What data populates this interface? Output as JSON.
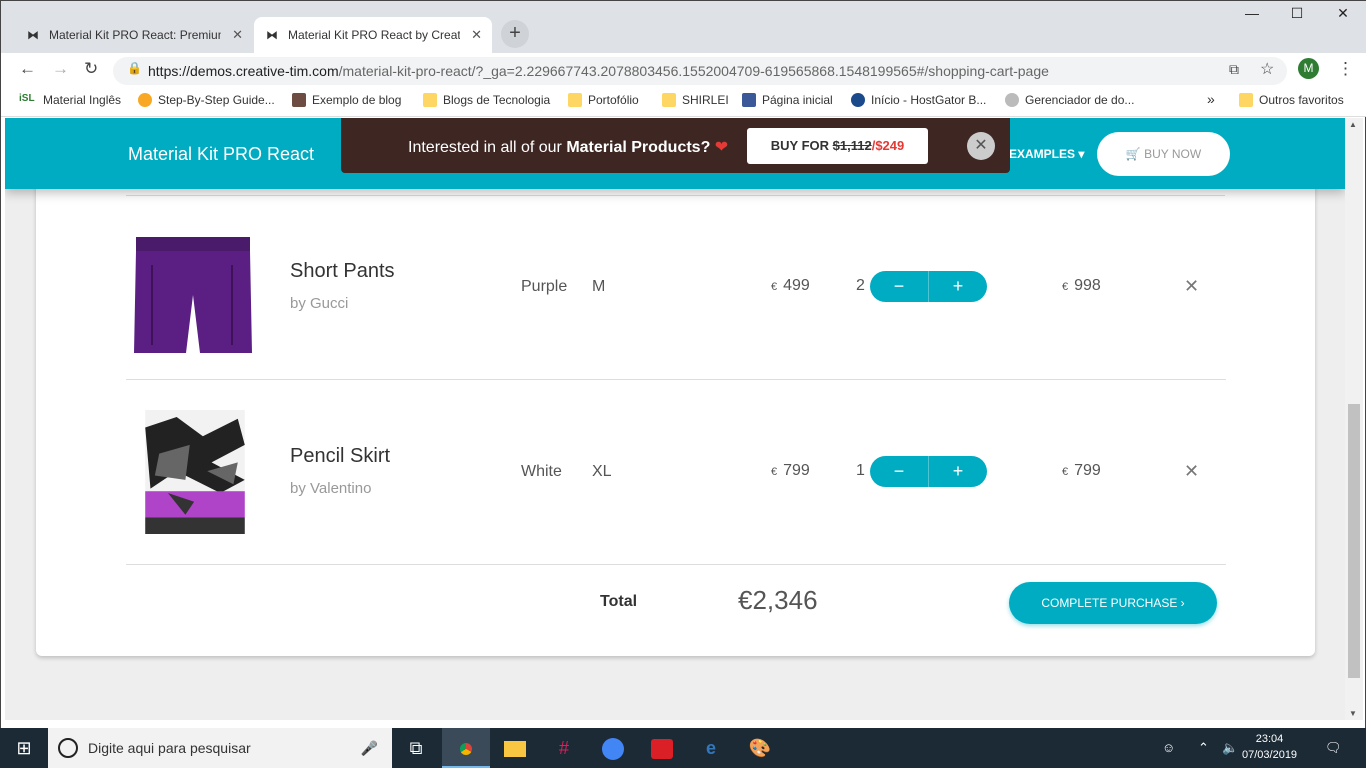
{
  "browser": {
    "tabs": [
      {
        "title": "Material Kit PRO React: Premium",
        "active": false
      },
      {
        "title": "Material Kit PRO React by Creativ",
        "active": true
      }
    ],
    "url_main": "https://demos.creative-tim.com",
    "url_rest": "/material-kit-pro-react/?_ga=2.229667743.2078803456.1552004709-619565868.1548199565#/shopping-cart-page",
    "avatar_letter": "M",
    "bookmarks": [
      "Material Inglês",
      "Step-By-Step Guide...",
      "Exemplo de blog",
      "Blogs de Tecnologia",
      "Portofólio",
      "SHIRLEI",
      "Página inicial",
      "Início - HostGator B...",
      "Gerenciador de do..."
    ],
    "bookmarks_overflow": "»",
    "other_bookmarks": "Outros favoritos"
  },
  "header": {
    "brand": "Material Kit PRO React",
    "examples": "EXAMPLES ▾",
    "buy_now": "BUY NOW"
  },
  "promo": {
    "text_pre": "Interested in all of our ",
    "text_bold": "Material Products?",
    "btn_prefix": "BUY FOR ",
    "old_price": "$1,112",
    "new_price": "$249"
  },
  "cart": {
    "items": [
      {
        "name": "Short Pants",
        "brand": "by Gucci",
        "color": "Purple",
        "size": "M",
        "price": "499",
        "qty": "2",
        "amount": "998"
      },
      {
        "name": "Pencil Skirt",
        "brand": "by Valentino",
        "color": "White",
        "size": "XL",
        "price": "799",
        "qty": "1",
        "amount": "799"
      }
    ],
    "currency": "€",
    "total_label": "Total",
    "total_value": "€2,346",
    "complete": "COMPLETE PURCHASE ›"
  },
  "taskbar": {
    "search_placeholder": "Digite aqui para pesquisar",
    "time": "23:04",
    "date": "07/03/2019"
  },
  "colors": {
    "accent": "#00acc1",
    "promo_bg": "#3e2723",
    "price_red": "#e53935"
  }
}
